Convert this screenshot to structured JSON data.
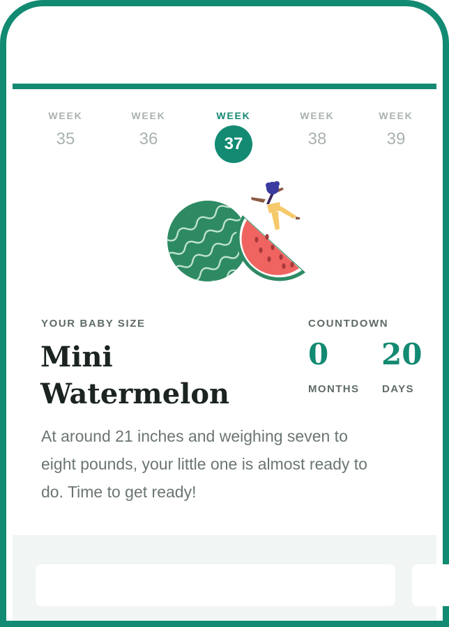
{
  "weeks": [
    {
      "label": "WEEK",
      "number": "35"
    },
    {
      "label": "WEEK",
      "number": "36"
    },
    {
      "label": "WEEK",
      "number": "37"
    },
    {
      "label": "WEEK",
      "number": "38"
    },
    {
      "label": "WEEK",
      "number": "39"
    }
  ],
  "selected_week": "37",
  "baby_size": {
    "label": "YOUR BABY SIZE",
    "fruit_line1": "Mini",
    "fruit_line2": "Watermelon"
  },
  "countdown": {
    "label": "COUNTDOWN",
    "months_value": "0",
    "months_label": "MONTHS",
    "days_value": "20",
    "days_label": "DAYS"
  },
  "description": "At around 21 inches and weighing seven to eight pounds, your little one is almost ready to do. Time to get ready!",
  "colors": {
    "accent": "#138a72",
    "watermelon_rind": "#2e8a63",
    "watermelon_flesh": "#ef6461",
    "figure_pants": "#f6c96a"
  }
}
